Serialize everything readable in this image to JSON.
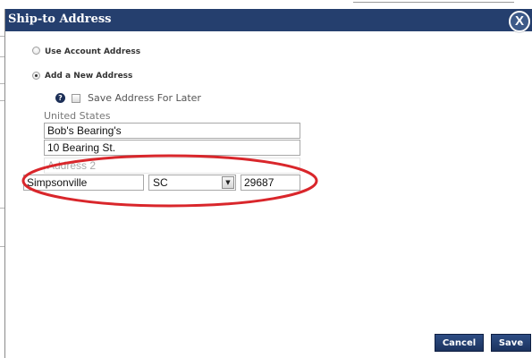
{
  "dialog": {
    "title": "Ship-to Address",
    "close_label": "X"
  },
  "options": {
    "use_account_address": {
      "label": "Use Account Address",
      "selected": false
    },
    "add_new_address": {
      "label": "Add a New Address",
      "selected": true
    }
  },
  "save_for_later": {
    "help_icon": "help-icon",
    "label": "Save Address For Later",
    "checked": false
  },
  "address": {
    "country": "United States",
    "name": "Bob's Bearing's",
    "address1": "10 Bearing St.",
    "address2_placeholder": "Address 2",
    "city": "Simpsonville",
    "state": "SC",
    "zip": "29687"
  },
  "buttons": {
    "cancel": "Cancel",
    "save": "Save"
  },
  "colors": {
    "titlebar": "#253f6e",
    "button": "#253f6e",
    "highlight_ring": "#d9262b"
  }
}
